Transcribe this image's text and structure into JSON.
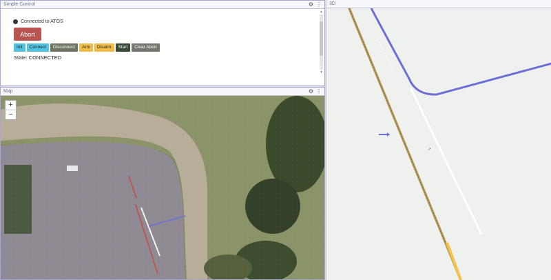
{
  "simple_control": {
    "title": "Simple Control",
    "connection_status": "Connected to ATOS",
    "abort_label": "Abort",
    "buttons": {
      "init": "Init",
      "connect": "Connect",
      "disconnect": "Disconnect",
      "arm": "Arm",
      "disarm": "Disarm",
      "start": "Start",
      "clear_abort": "Clear Abort"
    },
    "state_text": "State: CONNECTED"
  },
  "map": {
    "title": "Map",
    "zoom_in": "+",
    "zoom_out": "−"
  },
  "view3d": {
    "title": "3D"
  },
  "icons": {
    "settings": "gear-icon",
    "menu": "kebab-menu-icon"
  },
  "colors": {
    "abort": "#b85450",
    "info_button": "#4fc3df",
    "warning_button": "#f0bd4b",
    "dark_button": "#3b4834",
    "trajectory_blue": "#6b6fd6",
    "trajectory_red": "#c84a3a"
  }
}
